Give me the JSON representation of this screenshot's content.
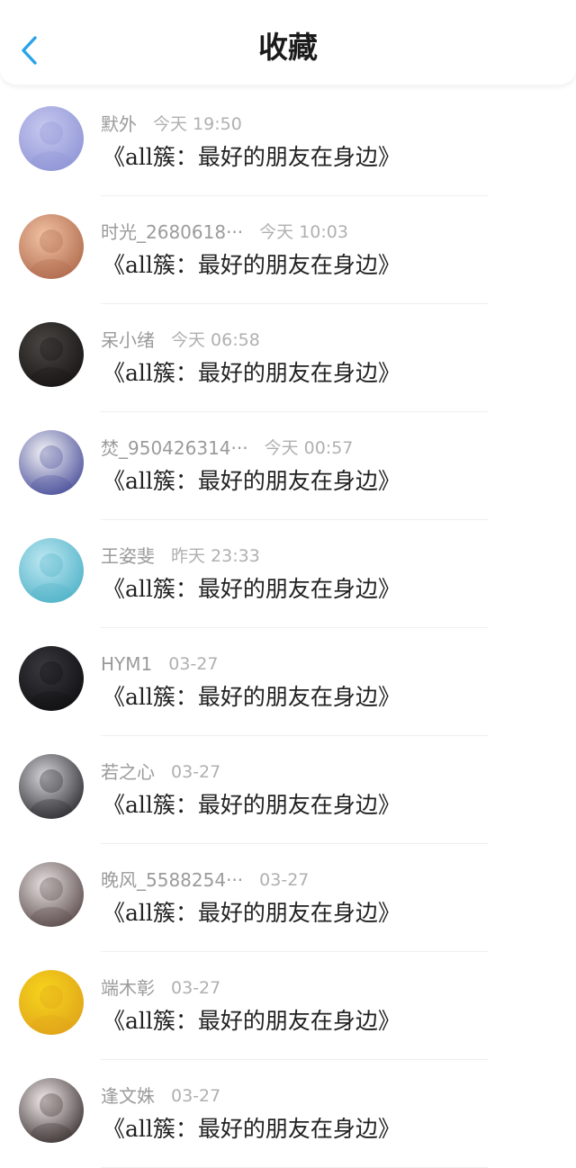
{
  "header": {
    "title": "收藏",
    "back_icon": "chevron-left-icon",
    "accent_color": "#2aa3e8"
  },
  "items": [
    {
      "user": "默外",
      "time": "今天 19:50",
      "content": "《all簇：最好的朋友在身边》",
      "avatar_colors": [
        "#c7c9ef",
        "#8f95d6"
      ]
    },
    {
      "user": "时光_2680618···",
      "time": "今天 10:03",
      "content": "《all簇：最好的朋友在身边》",
      "avatar_colors": [
        "#f2c3a5",
        "#b06a4c"
      ]
    },
    {
      "user": "呆小绪",
      "time": "今天 06:58",
      "content": "《all簇：最好的朋友在身边》",
      "avatar_colors": [
        "#4a4744",
        "#171514"
      ]
    },
    {
      "user": "焚_950426314···",
      "time": "今天 00:57",
      "content": "《all簇：最好的朋友在身边》",
      "avatar_colors": [
        "#f4f4f6",
        "#4a4f9a"
      ]
    },
    {
      "user": "王姿斐",
      "time": "昨天 23:33",
      "content": "《all簇：最好的朋友在身边》",
      "avatar_colors": [
        "#bfe8f2",
        "#4fb2c8"
      ]
    },
    {
      "user": "HYM1",
      "time": "03-27",
      "content": "《all簇：最好的朋友在身边》",
      "avatar_colors": [
        "#3a3a3e",
        "#0f0f12"
      ]
    },
    {
      "user": "若之心",
      "time": "03-27",
      "content": "《all簇：最好的朋友在身边》",
      "avatar_colors": [
        "#d6d6da",
        "#2a2a2f"
      ]
    },
    {
      "user": "晚风_5588254···",
      "time": "03-27",
      "content": "《all簇：最好的朋友在身边》",
      "avatar_colors": [
        "#e8e2e2",
        "#5a4a4a"
      ]
    },
    {
      "user": "端木彰",
      "time": "03-27",
      "content": "《all簇：最好的朋友在身边》",
      "avatar_colors": [
        "#f6d51c",
        "#e0a31a"
      ]
    },
    {
      "user": "逢文姝",
      "time": "03-27",
      "content": "《all簇：最好的朋友在身边》",
      "avatar_colors": [
        "#f4ecec",
        "#3b3232"
      ]
    }
  ]
}
